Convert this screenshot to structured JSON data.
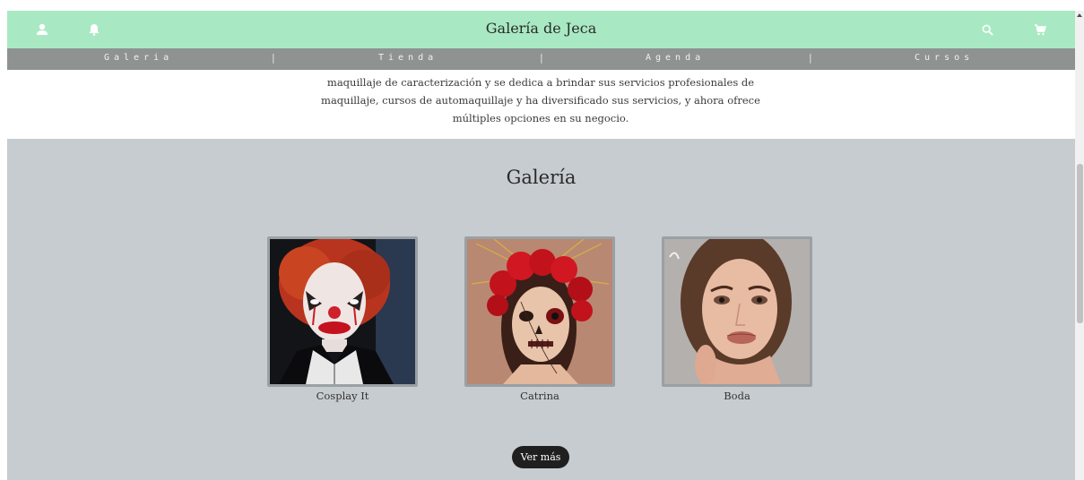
{
  "header": {
    "title": "Galería de Jeca"
  },
  "nav": {
    "items": [
      {
        "label": "Galeria"
      },
      {
        "label": "Tienda"
      },
      {
        "label": "Agenda"
      },
      {
        "label": "Cursos"
      }
    ],
    "separator": "|"
  },
  "intro": {
    "text": "maquillaje de caracterización y se dedica a brindar sus servicios profesionales de maquillaje, cursos de automaquillaje y ha diversificado sus servicios, y ahora ofrece múltiples opciones en su negocio."
  },
  "gallery": {
    "title": "Galería",
    "items": [
      {
        "caption": "Cosplay It"
      },
      {
        "caption": "Catrina"
      },
      {
        "caption": "Boda"
      }
    ],
    "more_label": "Ver más"
  },
  "icons": {
    "user": "user-icon",
    "bell": "bell-icon",
    "search": "search-icon",
    "cart": "cart-icon"
  },
  "colors": {
    "header_bg": "#a8e9c3",
    "nav_bg": "#8e9291",
    "gallery_bg": "#c7ccd0",
    "button_bg": "#1f1f1f"
  }
}
